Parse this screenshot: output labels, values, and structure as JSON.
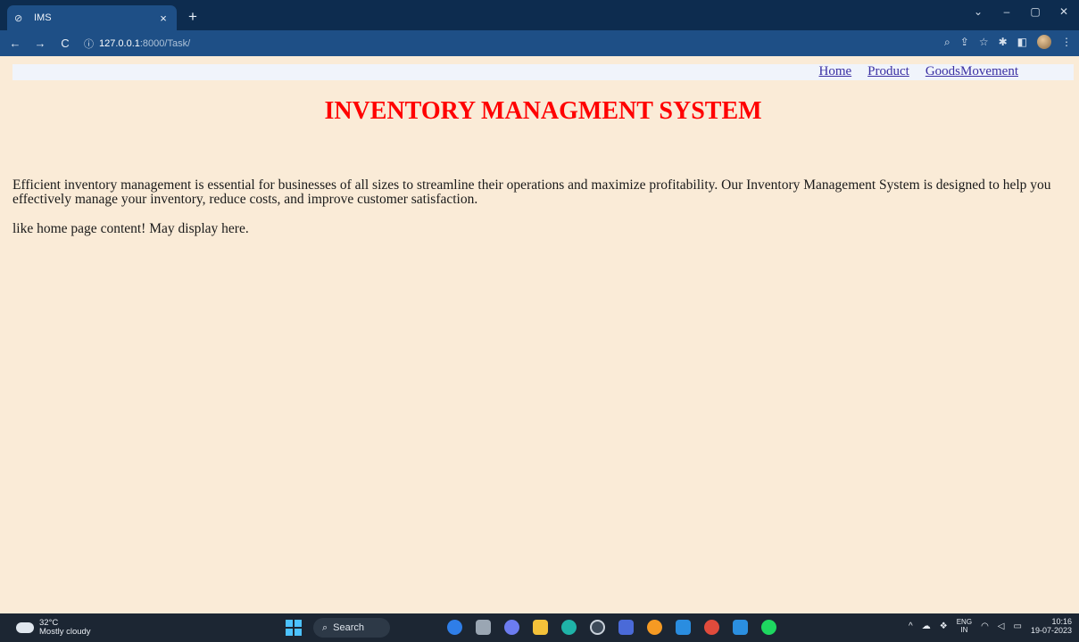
{
  "browser": {
    "tab_title": "IMS",
    "tab_close": "×",
    "new_tab": "+",
    "url_host": "127.0.0.1",
    "url_path": ":8000/Task/",
    "nav_back": "←",
    "nav_forward": "→",
    "nav_reload": "C"
  },
  "page": {
    "nav_links": [
      "Home",
      "Product",
      "GoodsMovement"
    ],
    "title": "INVENTORY MANAGMENT SYSTEM",
    "intro": "Efficient inventory management is essential for businesses of all sizes to streamline their operations and maximize profitability. Our Inventory Management System is designed to help you effectively manage your inventory, reduce costs, and improve customer satisfaction.",
    "note": "like home page content! May display here."
  },
  "taskbar": {
    "weather_temp": "32°C",
    "weather_desc": "Mostly cloudy",
    "search_label": "Search",
    "lang_top": "ENG",
    "lang_bottom": "IN",
    "time": "10:16",
    "date": "19-07-2023"
  },
  "colors": {
    "page_bg": "#faebd7",
    "title": "#ff0000",
    "link": "#3a2fa3",
    "chrome_dark": "#0d2c4f",
    "chrome": "#1e4f86"
  }
}
